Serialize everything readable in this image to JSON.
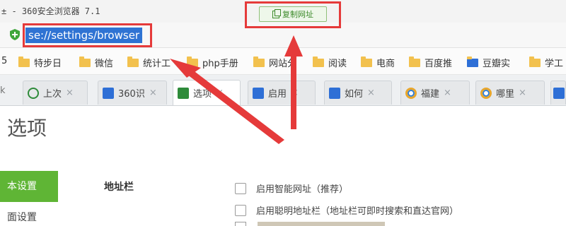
{
  "window": {
    "title": "± - 360安全浏览器 7.1",
    "copy_url_label": "复制网址"
  },
  "address_bar": {
    "url": "se://settings/browser"
  },
  "bookmarks": {
    "edge_left": "5",
    "items": [
      {
        "label": "特步日"
      },
      {
        "label": "微信"
      },
      {
        "label": "统计工"
      },
      {
        "label": "php手册"
      },
      {
        "label": "网站分"
      },
      {
        "label": "阅读"
      },
      {
        "label": "电商"
      },
      {
        "label": "百度推"
      },
      {
        "label": "豆瓣实"
      },
      {
        "label": "学工"
      }
    ]
  },
  "tabs": {
    "edge_left": "k",
    "items": [
      {
        "label": "上次",
        "icon": "clock-icon"
      },
      {
        "label": "360识",
        "icon": "paw-icon"
      },
      {
        "label": "选项",
        "icon": "wrench-icon"
      },
      {
        "label": "启用",
        "icon": "paw-icon"
      },
      {
        "label": "如何",
        "icon": "paw-icon"
      },
      {
        "label": "福建",
        "icon": "ring-icon"
      },
      {
        "label": "哪里",
        "icon": "ring-icon"
      }
    ],
    "close_glyph": "×"
  },
  "content": {
    "page_title": "选项",
    "sidebar": [
      "本设置",
      "面设置"
    ],
    "section_label": "地址栏",
    "options": [
      {
        "label": "启用智能网址（推荐）",
        "checked": false
      },
      {
        "label": "启用聪明地址栏（地址栏可即时搜索和直达官网）",
        "checked": false
      }
    ]
  },
  "colors": {
    "highlight": "#2f73d3",
    "accent_green": "#5fb535",
    "annotation_red": "#e53a3a"
  }
}
